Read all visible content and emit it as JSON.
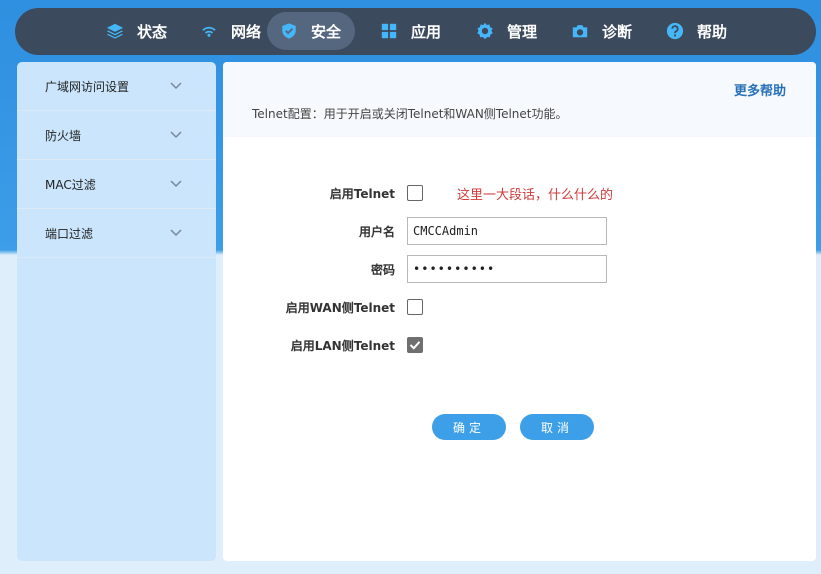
{
  "nav": {
    "items": [
      {
        "label": "状态",
        "icon": "layers-icon"
      },
      {
        "label": "网络",
        "icon": "wifi-icon"
      },
      {
        "label": "安全",
        "icon": "shield-icon",
        "active": true
      },
      {
        "label": "应用",
        "icon": "grid-icon"
      },
      {
        "label": "管理",
        "icon": "gear-icon"
      },
      {
        "label": "诊断",
        "icon": "camera-icon"
      },
      {
        "label": "帮助",
        "icon": "help-icon"
      }
    ]
  },
  "sidebar": {
    "items": [
      {
        "label": "广域网访问设置"
      },
      {
        "label": "防火墙"
      },
      {
        "label": "MAC过滤"
      },
      {
        "label": "端口过滤"
      }
    ]
  },
  "main": {
    "more_help": "更多帮助",
    "description": "Telnet配置：用于开启或关闭Telnet和WAN侧Telnet功能。"
  },
  "form": {
    "enable_telnet_label": "启用Telnet",
    "enable_telnet_checked": false,
    "note": "这里一大段话，什么什么的",
    "username_label": "用户名",
    "username_value": "CMCCAdmin",
    "password_label": "密码",
    "password_value": "••••••••••",
    "wan_telnet_label": "启用WAN侧Telnet",
    "wan_telnet_checked": false,
    "lan_telnet_label": "启用LAN侧Telnet",
    "lan_telnet_checked": true
  },
  "buttons": {
    "confirm": "确定",
    "cancel": "取消"
  },
  "colors": {
    "nav_bg": "#3c4a5e",
    "accent": "#3d9fe8",
    "icon": "#45b6f7",
    "note": "#d23a3a",
    "sidebar": "#cbe6fc"
  }
}
